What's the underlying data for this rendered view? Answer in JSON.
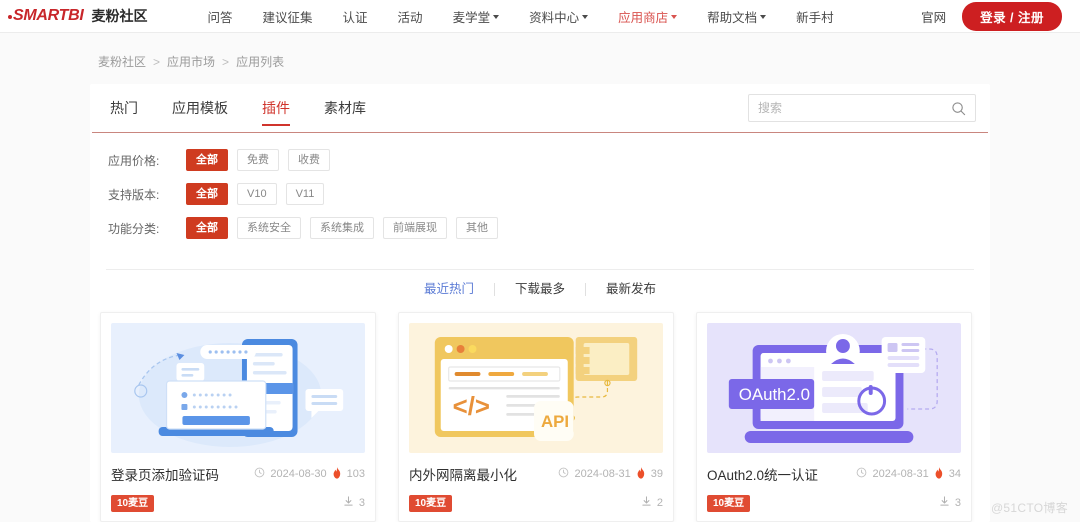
{
  "header": {
    "logo_mark": "SMARTBI",
    "logo_text": "麦粉社区",
    "nav": [
      {
        "label": "问答",
        "dropdown": false,
        "active": false
      },
      {
        "label": "建议征集",
        "dropdown": false,
        "active": false
      },
      {
        "label": "认证",
        "dropdown": false,
        "active": false
      },
      {
        "label": "活动",
        "dropdown": false,
        "active": false
      },
      {
        "label": "麦学堂",
        "dropdown": true,
        "active": false
      },
      {
        "label": "资料中心",
        "dropdown": true,
        "active": false
      },
      {
        "label": "应用商店",
        "dropdown": true,
        "active": true
      },
      {
        "label": "帮助文档",
        "dropdown": true,
        "active": false
      },
      {
        "label": "新手村",
        "dropdown": false,
        "active": false
      }
    ],
    "official_site": "官网",
    "login_label": "登录 / 注册",
    "brand_color": "#cd1f21",
    "active_nav_color": "#d9534f"
  },
  "breadcrumb": {
    "items": [
      "麦粉社区",
      "应用市场",
      "应用列表"
    ],
    "separator": ">"
  },
  "tabs": [
    {
      "label": "热门",
      "active": false
    },
    {
      "label": "应用模板",
      "active": false
    },
    {
      "label": "插件",
      "active": true
    },
    {
      "label": "素材库",
      "active": false
    }
  ],
  "search": {
    "placeholder": "搜索",
    "value": "",
    "icon": "search-icon"
  },
  "filters": [
    {
      "label": "应用价格:",
      "options": [
        {
          "label": "全部",
          "active": true
        },
        {
          "label": "免费",
          "active": false
        },
        {
          "label": "收费",
          "active": false
        }
      ]
    },
    {
      "label": "支持版本:",
      "options": [
        {
          "label": "全部",
          "active": true
        },
        {
          "label": "V10",
          "active": false
        },
        {
          "label": "V11",
          "active": false
        }
      ]
    },
    {
      "label": "功能分类:",
      "options": [
        {
          "label": "全部",
          "active": true
        },
        {
          "label": "系统安全",
          "active": false
        },
        {
          "label": "系统集成",
          "active": false
        },
        {
          "label": "前端展现",
          "active": false
        },
        {
          "label": "其他",
          "active": false
        }
      ]
    }
  ],
  "sort": [
    {
      "label": "最近热门",
      "active": true
    },
    {
      "label": "下载最多",
      "active": false
    },
    {
      "label": "最新发布",
      "active": false
    }
  ],
  "cards": [
    {
      "title": "登录页添加验证码",
      "date": "2024-08-30",
      "hot": "103",
      "price": "10麦豆",
      "downloads": "3",
      "thumb_kind": "login-illustration",
      "thumb_bg": "#e8f0fd",
      "thumb_label": ""
    },
    {
      "title": "内外网隔离最小化",
      "date": "2024-08-31",
      "hot": "39",
      "price": "10麦豆",
      "downloads": "2",
      "thumb_kind": "api-illustration",
      "thumb_bg": "#fdf3dd",
      "thumb_label": "API"
    },
    {
      "title": "OAuth2.0统一认证",
      "date": "2024-08-31",
      "hot": "34",
      "price": "10麦豆",
      "downloads": "3",
      "thumb_kind": "oauth-illustration",
      "thumb_bg": "#e6e3fb",
      "thumb_label": "OAuth2.0"
    }
  ],
  "watermark": "@51CTO博客",
  "icons": {
    "clock": "clock-icon",
    "fire": "fire-icon",
    "download": "download-icon"
  }
}
